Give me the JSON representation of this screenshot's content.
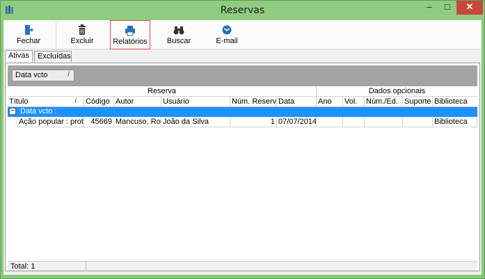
{
  "window": {
    "title": "Reservas",
    "minimize": "‒",
    "maximize": "□",
    "close": "✕"
  },
  "toolbar": {
    "fechar": "Fechar",
    "excluir": "Excluir",
    "relatorios": "Relatórios",
    "buscar": "Buscar",
    "email": "E-mail"
  },
  "tabs": {
    "ativas": "Ativas",
    "excluidas": "Excluídas"
  },
  "grid": {
    "group_chip": "Data vcto",
    "group_chip_sort": "/",
    "band_reserva": "Reserva",
    "band_dados": "Dados opcionais",
    "columns": {
      "titulo": "Título",
      "titulo_sort": "/",
      "codigo": "Código",
      "autor": "Autor",
      "usuario": "Usuário",
      "num_reserva": "Núm. Reserva",
      "data": "Data",
      "ano": "Ano",
      "vol": "Vol.",
      "num_ed": "Núm./Ed.",
      "suporte": "Suporte",
      "biblioteca": "Biblioteca"
    },
    "group_row": {
      "expander": "−",
      "label": "Data vcto :"
    },
    "rows": [
      {
        "titulo": "Ação popular : prote",
        "codigo": "45669",
        "autor": "Mancuso, Rod",
        "usuario": "João da Silva",
        "num_reserva": "1",
        "data": "07/07/2014",
        "ano": "",
        "vol": "",
        "num_ed": "",
        "suporte": "",
        "biblioteca": "Biblioteca"
      }
    ]
  },
  "footer": {
    "total": "Total: 1"
  },
  "colors": {
    "window_frame": "#88c87a",
    "close_button": "#c7473a",
    "group_row": "#1e90ff",
    "group_bar": "#a3a3a3",
    "active_button_border": "#d9463b"
  },
  "icons": {
    "fechar": "exit-door-icon",
    "excluir": "trash-icon",
    "relatorios": "printer-icon",
    "buscar": "binoculars-icon",
    "email": "email-icon",
    "app": "books-icon"
  }
}
